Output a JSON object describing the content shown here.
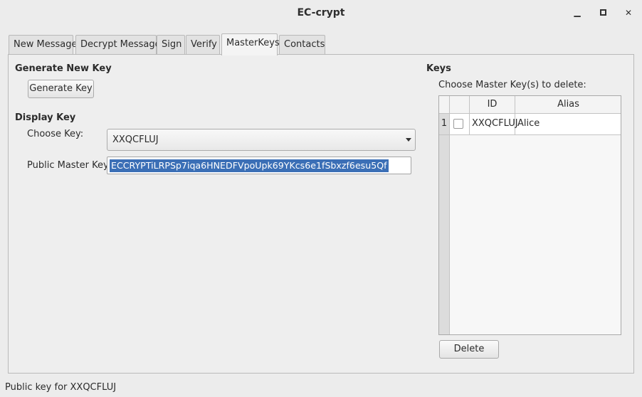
{
  "window": {
    "title": "EC-crypt",
    "minimize_glyph": "▁",
    "maximize_glyph": "▫",
    "close_glyph": "✕"
  },
  "tabs": [
    {
      "label": "New Message"
    },
    {
      "label": "Decrypt Message"
    },
    {
      "label": "Sign"
    },
    {
      "label": "Verify"
    },
    {
      "label": "MasterKeys",
      "active": true
    },
    {
      "label": "Contacts"
    }
  ],
  "generate": {
    "heading": "Generate New Key",
    "button_label": "Generate Key"
  },
  "display": {
    "heading": "Display Key",
    "choose_label": "Choose Key:",
    "choose_value": "XXQCFLUJ",
    "public_label": "Public Master Key:",
    "public_value": "ECCRYPTiLRPSp7iqa6HNEDFVpoUpk69YKcs6e1fSbxzf6esu5Qf"
  },
  "keys": {
    "heading": "Keys",
    "instruction": "Choose Master Key(s) to delete:",
    "columns": [
      "",
      "ID",
      "Alias"
    ],
    "rows": [
      {
        "index": "1",
        "checked": false,
        "id": "XXQCFLUJ",
        "alias": "Alice"
      }
    ],
    "delete_label": "Delete"
  },
  "status": {
    "text": "Public key for XXQCFLUJ"
  },
  "colors": {
    "selection": "#3b6fb6",
    "background": "#ececec"
  }
}
